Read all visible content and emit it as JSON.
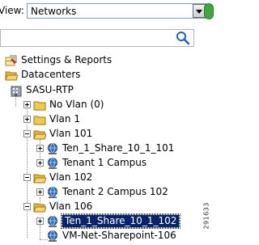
{
  "toolbar": {
    "view_label": "View:",
    "view_value": "Networks"
  },
  "search": {
    "placeholder": ""
  },
  "tree": {
    "settings_label": "Settings & Reports",
    "datacenters_label": "Datacenters",
    "site_label": "SASU-RTP",
    "items": [
      {
        "label": "No Vlan (0)"
      },
      {
        "label": "Vlan 1"
      },
      {
        "label": "Vlan 101"
      },
      {
        "label": "Ten_1_Share_10_1_101"
      },
      {
        "label": "Tenant 1 Campus"
      },
      {
        "label": "Vlan 102"
      },
      {
        "label": "Tenant 2 Campus 102"
      },
      {
        "label": "Vlan 106"
      },
      {
        "label": "Ten_1_Share_10_1_102"
      },
      {
        "label": "VM-Net-Sharepoint-106"
      }
    ]
  },
  "figure_id": "291633",
  "colors": {
    "selection_bg": "#0a246a",
    "folder": "#f2c94c",
    "network_globe": "#2f6fbd"
  }
}
